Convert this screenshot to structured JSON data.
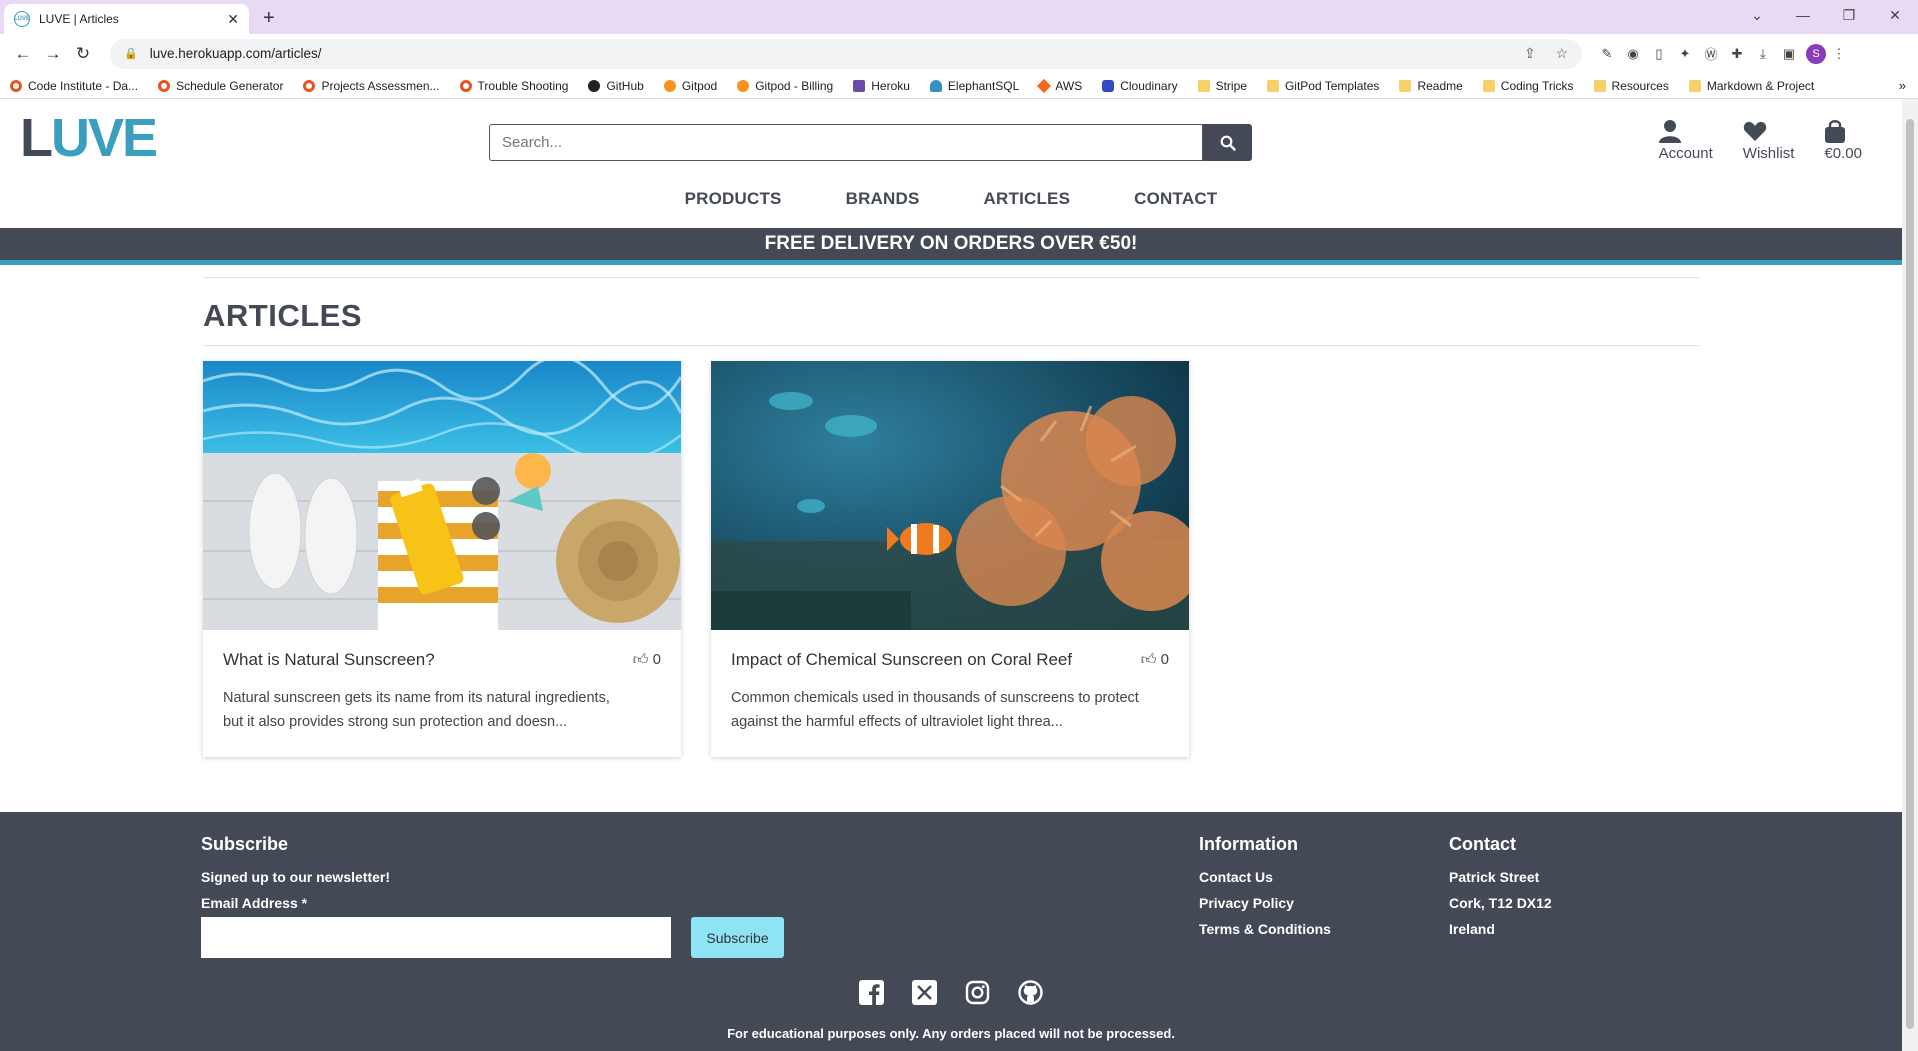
{
  "browser": {
    "tab_title": "LUVE | Articles",
    "favicon_text": "LUVE",
    "url": "luve.herokuapp.com/articles/",
    "profile_initial": "S",
    "bookmarks": [
      {
        "label": "Code Institute - Da...",
        "icon": "ring"
      },
      {
        "label": "Schedule Generator",
        "icon": "ring"
      },
      {
        "label": "Projects Assessmen...",
        "icon": "ring"
      },
      {
        "label": "Trouble Shooting",
        "icon": "ring"
      },
      {
        "label": "GitHub",
        "icon": "gh"
      },
      {
        "label": "Gitpod",
        "icon": "gp"
      },
      {
        "label": "Gitpod - Billing",
        "icon": "gp"
      },
      {
        "label": "Heroku",
        "icon": "hk"
      },
      {
        "label": "ElephantSQL",
        "icon": "el"
      },
      {
        "label": "AWS",
        "icon": "aws"
      },
      {
        "label": "Cloudinary",
        "icon": "cl"
      },
      {
        "label": "Stripe",
        "icon": "folder"
      },
      {
        "label": "GitPod Templates",
        "icon": "folder"
      },
      {
        "label": "Readme",
        "icon": "folder"
      },
      {
        "label": "Coding Tricks",
        "icon": "folder"
      },
      {
        "label": "Resources",
        "icon": "folder"
      },
      {
        "label": "Markdown & Project",
        "icon": "folder"
      }
    ]
  },
  "header": {
    "logo": {
      "first": "L",
      "rest": "UVE"
    },
    "search_placeholder": "Search...",
    "account_label": "Account",
    "wishlist_label": "Wishlist",
    "bag_total": "€0.00"
  },
  "nav": [
    "PRODUCTS",
    "BRANDS",
    "ARTICLES",
    "CONTACT"
  ],
  "banner": "FREE DELIVERY ON ORDERS OVER €50!",
  "page_title": "ARTICLES",
  "articles": [
    {
      "title": "What is Natural Sunscreen?",
      "likes": "0",
      "excerpt_1": "Natural sunscreen gets its name from its natural ingredients,",
      "excerpt_2": "but it also provides strong sun protection and doesn..."
    },
    {
      "title": "Impact of Chemical Sunscreen on Coral Reef",
      "likes": "0",
      "excerpt_1": "Common chemicals used in thousands of sunscreens to protect",
      "excerpt_2": "against the harmful effects of ultraviolet light threa..."
    }
  ],
  "footer": {
    "subscribe_title": "Subscribe",
    "subscribe_text": "Signed up to our newsletter!",
    "email_label": "Email Address *",
    "subscribe_button": "Subscribe",
    "info_title": "Information",
    "info_links": [
      "Contact Us",
      "Privacy Policy",
      "Terms & Conditions"
    ],
    "contact_title": "Contact",
    "contact_lines": [
      "Patrick Street",
      "Cork, T12 DX12",
      "Ireland"
    ],
    "socials": [
      "facebook-icon",
      "x-icon",
      "instagram-icon",
      "github-icon"
    ],
    "disclaimer": "For educational purposes only. Any orders placed will not be processed."
  },
  "colors": {
    "brand_teal": "#3a9fbf",
    "brand_dark": "#444a55",
    "subscribe_btn": "#8ee3f5",
    "tabbar": "#e8d9f5"
  }
}
